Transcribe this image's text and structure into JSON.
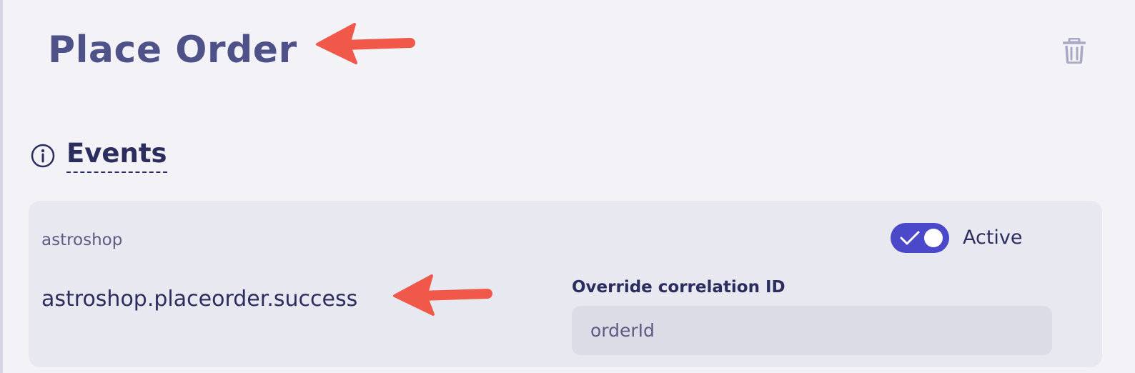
{
  "header": {
    "title": "Place Order",
    "delete_icon": "trash-icon"
  },
  "events_section": {
    "title": "Events",
    "info_icon": "info-icon"
  },
  "event_card": {
    "source": "astroshop",
    "event_type": "astroshop.placeorder.success",
    "toggle": {
      "label": "Active",
      "checked": true
    },
    "override_field": {
      "label": "Override correlation ID",
      "placeholder": "orderId"
    }
  },
  "annotations": {
    "arrow_color": "#f0584a"
  },
  "colors": {
    "title": "#4f5189",
    "text_dark": "#2b2d5e",
    "toggle_on": "#4b48c9",
    "background": "#f2f2f7",
    "card": "#e8e8f0"
  }
}
